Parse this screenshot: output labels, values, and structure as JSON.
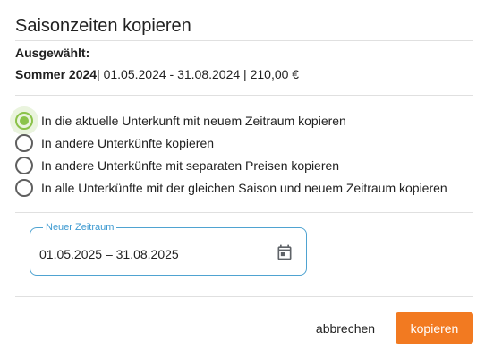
{
  "dialog": {
    "title": "Saisonzeiten kopieren"
  },
  "selection": {
    "label": "Ausgewählt:",
    "season_name": "Sommer 2024",
    "details": "| 01.05.2024 - 31.08.2024 | 210,00 €"
  },
  "options": [
    {
      "label": "In die aktuelle Unterkunft mit neuem Zeitraum kopieren",
      "checked": true
    },
    {
      "label": "In andere Unterkünfte kopieren",
      "checked": false
    },
    {
      "label": "In andere Unterkünfte mit separaten Preisen kopieren",
      "checked": false
    },
    {
      "label": "In alle Unterkünfte mit der gleichen Saison und neuem Zeitraum kopieren",
      "checked": false
    }
  ],
  "date_range": {
    "label": "Neuer Zeitraum",
    "value": "01.05.2025 – 31.08.2025",
    "icon": "calendar-icon"
  },
  "buttons": {
    "cancel": "abbrechen",
    "copy": "kopieren"
  },
  "colors": {
    "accent_green": "#8bc34a",
    "field_blue": "#4fa3d1",
    "primary_orange": "#f27a21"
  }
}
